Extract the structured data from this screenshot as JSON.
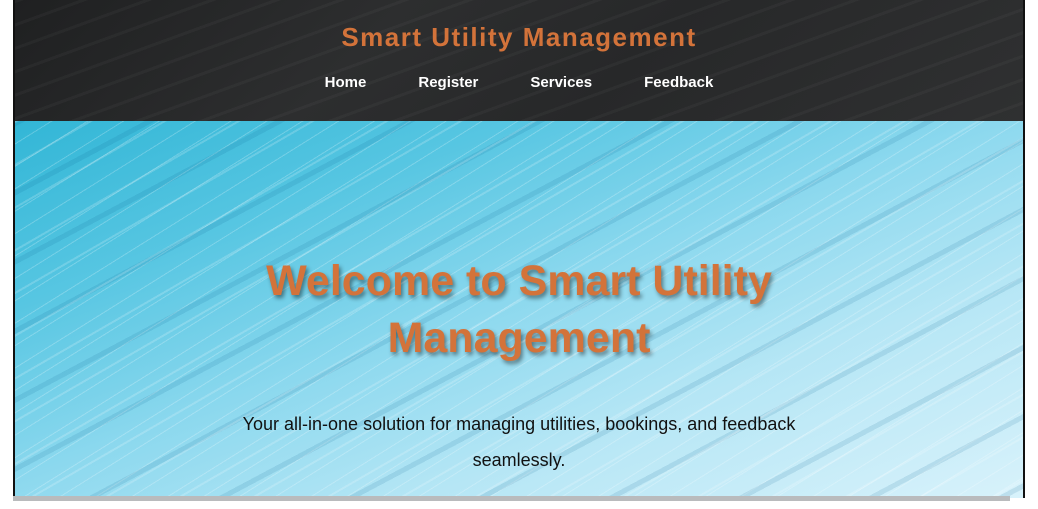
{
  "header": {
    "title": "Smart Utility Management",
    "nav": [
      {
        "label": "Home"
      },
      {
        "label": "Register"
      },
      {
        "label": "Services"
      },
      {
        "label": "Feedback"
      }
    ]
  },
  "hero": {
    "title": "Welcome to Smart Utility Management",
    "subtitle": "Your all-in-one solution for managing utilities, bookings, and feedback seamlessly."
  },
  "colors": {
    "accent": "#d3733a",
    "header_bg": "#2a2b2c",
    "hero_bg": "#57c6e2"
  }
}
